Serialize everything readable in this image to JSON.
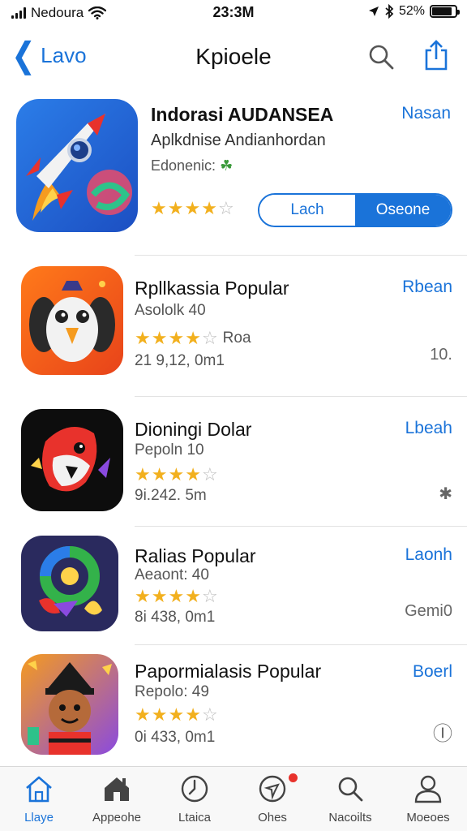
{
  "status_bar": {
    "carrier": "Nedoura",
    "time": "23:3M",
    "battery": "52%",
    "battery_level": 0.85
  },
  "nav": {
    "back_label": "Lavo",
    "title": "Kpioele",
    "icons": [
      "chevron-left-icon",
      "search-icon",
      "share-icon"
    ]
  },
  "featured": {
    "title": "Indorasi AUDANSEA",
    "subtitle": "Aplkdnise Andianhordan",
    "meta": "Edonenic:",
    "action": "Nasan",
    "rating": 4,
    "segment_left": "Lach",
    "segment_right": "Oseone"
  },
  "rows": [
    {
      "title": "Rpllkassia Popular",
      "subtitle": "Asololk 40",
      "rating": 4,
      "rating_label": "Roa",
      "size": "21 9,12, 0m1",
      "action": "Rbean",
      "extra": "10."
    },
    {
      "title": "Dioningi Dolar",
      "subtitle": "Pepoln 10",
      "rating": 4,
      "rating_label": "",
      "size": "9i.242. 5m",
      "action": "Lbeah",
      "extra": "✱"
    },
    {
      "title": "Ralias Popular",
      "subtitle": "Aeaont: 40",
      "rating": 4,
      "rating_label": "",
      "size": "8i 438, 0m1",
      "action": "Laonh",
      "extra": "Gemi0"
    },
    {
      "title": "Papormialasis Popular",
      "subtitle": "Repolo: 49",
      "rating": 4,
      "rating_label": "",
      "size": "0i 433, 0m1",
      "action": "Boerl",
      "extra": "Ⓘ"
    }
  ],
  "tabs": [
    {
      "label": "Llaye",
      "icon": "home-icon",
      "active": true
    },
    {
      "label": "Appeohe",
      "icon": "house-icon",
      "active": false
    },
    {
      "label": "Ltaica",
      "icon": "clock-icon",
      "active": false
    },
    {
      "label": "Ohes",
      "icon": "compass-icon",
      "active": false,
      "badge": true
    },
    {
      "label": "Nacoilts",
      "icon": "search-icon",
      "active": false
    },
    {
      "label": "Moeoes",
      "icon": "person-icon",
      "active": false
    }
  ],
  "colors": {
    "accent": "#1a73d9",
    "star": "#f2b01e",
    "badge": "#e8322c"
  }
}
